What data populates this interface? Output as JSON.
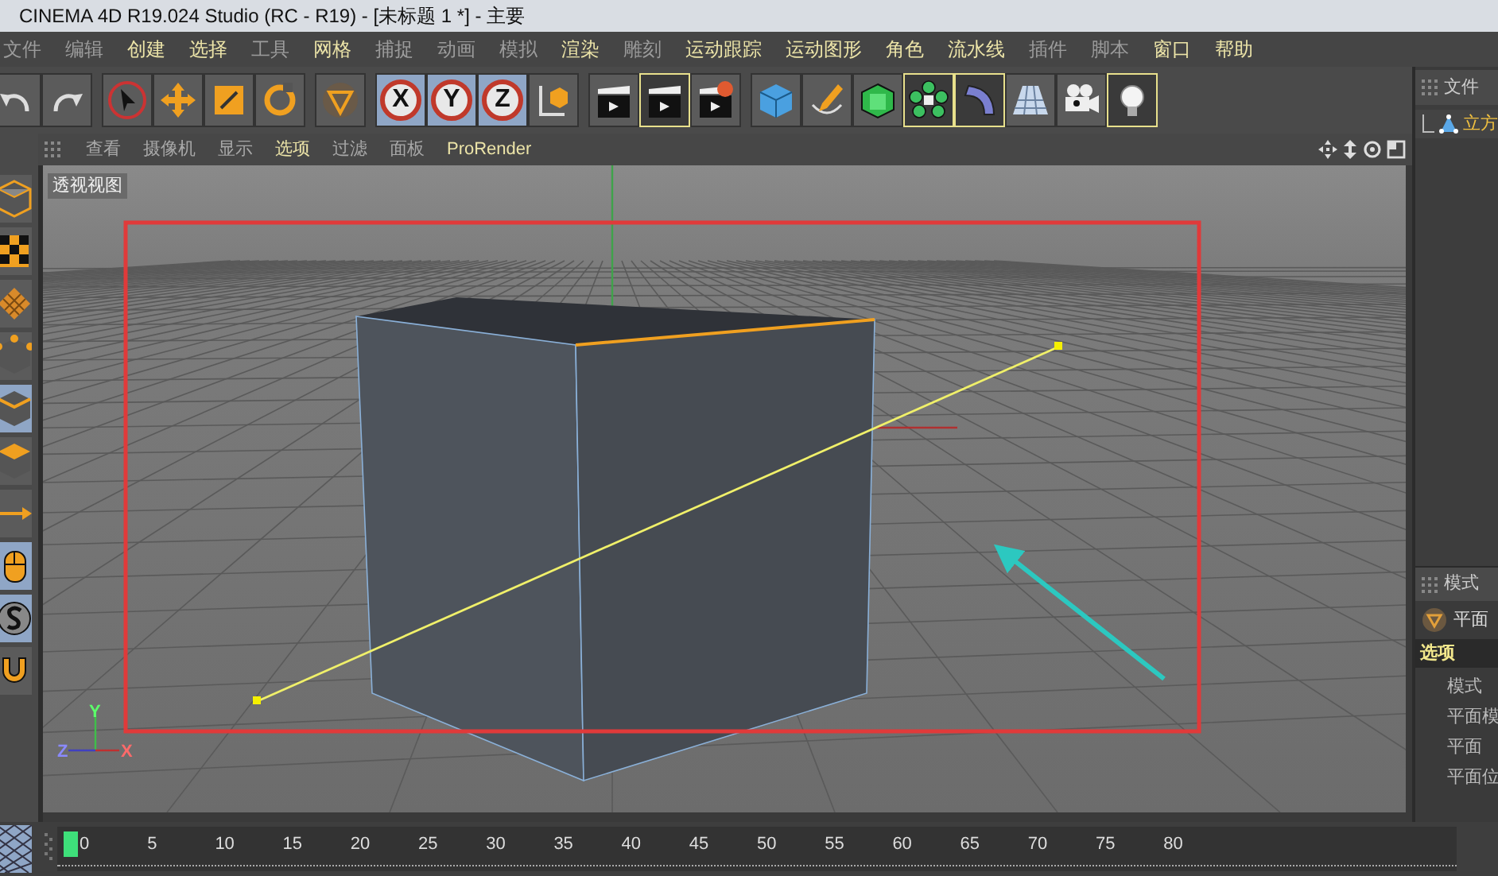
{
  "window": {
    "title": "CINEMA 4D R19.024 Studio (RC - R19) - [未标题 1 *] - 主要"
  },
  "menu": [
    {
      "label": "文件",
      "dim": true
    },
    {
      "label": "编辑",
      "dim": true
    },
    {
      "label": "创建",
      "dim": false
    },
    {
      "label": "选择",
      "dim": false
    },
    {
      "label": "工具",
      "dim": true
    },
    {
      "label": "网格",
      "dim": false
    },
    {
      "label": "捕捉",
      "dim": true
    },
    {
      "label": "动画",
      "dim": true
    },
    {
      "label": "模拟",
      "dim": true
    },
    {
      "label": "渲染",
      "dim": false
    },
    {
      "label": "雕刻",
      "dim": true
    },
    {
      "label": "运动跟踪",
      "dim": false
    },
    {
      "label": "运动图形",
      "dim": false
    },
    {
      "label": "角色",
      "dim": false
    },
    {
      "label": "流水线",
      "dim": false
    },
    {
      "label": "插件",
      "dim": true
    },
    {
      "label": "脚本",
      "dim": true
    },
    {
      "label": "窗口",
      "dim": false
    },
    {
      "label": "帮助",
      "dim": false
    }
  ],
  "toolbar": [
    [
      {
        "kind": "undo",
        "selected": false
      },
      {
        "kind": "redo",
        "selected": false
      }
    ],
    [
      {
        "kind": "select",
        "selected": false
      },
      {
        "kind": "move",
        "selected": false
      },
      {
        "kind": "scale",
        "selected": false
      },
      {
        "kind": "rotate",
        "selected": false
      }
    ],
    [
      {
        "kind": "object",
        "selected": false
      }
    ],
    [
      {
        "kind": "axis",
        "label": "X",
        "selected": true
      },
      {
        "kind": "axis",
        "label": "Y",
        "selected": true
      },
      {
        "kind": "axis",
        "label": "Z",
        "selected": true
      },
      {
        "kind": "coords",
        "selected": false
      }
    ],
    [
      {
        "kind": "clapper",
        "selected": false
      },
      {
        "kind": "clapper",
        "selected": true
      },
      {
        "kind": "clapper-gear",
        "selected": false
      }
    ],
    [
      {
        "kind": "cube",
        "selected": false
      },
      {
        "kind": "pen",
        "selected": false
      },
      {
        "kind": "subdivision",
        "selected": false
      },
      {
        "kind": "cloner",
        "selected": true
      },
      {
        "kind": "deformer",
        "selected": true
      },
      {
        "kind": "floor",
        "selected": false
      },
      {
        "kind": "camera",
        "selected": false
      },
      {
        "kind": "light",
        "selected": true
      }
    ]
  ],
  "viewport": {
    "menu": [
      {
        "label": "查看",
        "highlighted": false
      },
      {
        "label": "摄像机",
        "highlighted": false
      },
      {
        "label": "显示",
        "highlighted": false
      },
      {
        "label": "选项",
        "highlighted": true
      },
      {
        "label": "过滤",
        "highlighted": false
      },
      {
        "label": "面板",
        "highlighted": false
      },
      {
        "label": "ProRender",
        "highlighted": true
      }
    ],
    "view_name": "透视视图",
    "axes": [
      "Y",
      "Z",
      "X"
    ]
  },
  "left_tools": [
    {
      "kind": "cube",
      "selected": false
    },
    {
      "kind": "checker",
      "selected": false
    },
    {
      "kind": "grid",
      "selected": false
    },
    {
      "kind": "points",
      "selected": false
    },
    {
      "kind": "edges",
      "selected": true
    },
    {
      "kind": "polygons",
      "selected": false
    },
    {
      "kind": "arrow",
      "selected": false
    },
    {
      "kind": "mouse",
      "selected": true
    },
    {
      "kind": "s",
      "selected": true
    },
    {
      "kind": "magnet",
      "selected": false
    }
  ],
  "objects_panel": {
    "title": "文件",
    "items": [
      {
        "label": "立方"
      }
    ]
  },
  "attributes_panel": {
    "title": "模式",
    "object": "平面",
    "tabs": [
      {
        "label": "选项",
        "selected": true
      }
    ],
    "fields": [
      "模式",
      "平面模",
      "平面",
      "平面位"
    ]
  },
  "timeline": {
    "ticks": [
      "0",
      "5",
      "10",
      "15",
      "20",
      "25",
      "30",
      "35",
      "40",
      "45",
      "50",
      "55",
      "60",
      "65",
      "70",
      "75",
      "80"
    ]
  }
}
